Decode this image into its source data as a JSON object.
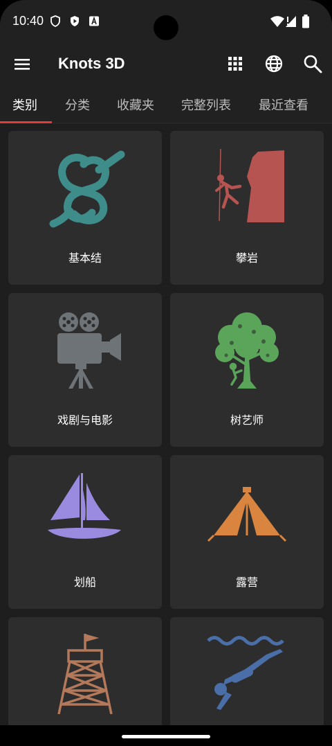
{
  "status": {
    "time": "10:40"
  },
  "app": {
    "title": "Knots 3D"
  },
  "tabs": [
    "类别",
    "分类",
    "收藏夹",
    "完整列表",
    "最近查看"
  ],
  "categories": [
    {
      "label": "基本结",
      "icon": "knot-icon",
      "color": "#3f8d8a"
    },
    {
      "label": "攀岩",
      "icon": "climbing-icon",
      "color": "#b55450"
    },
    {
      "label": "戏剧与电影",
      "icon": "film-camera-icon",
      "color": "#6e7377"
    },
    {
      "label": "树艺师",
      "icon": "tree-icon",
      "color": "#5aa55a"
    },
    {
      "label": "划船",
      "icon": "sailboat-icon",
      "color": "#9b8be0"
    },
    {
      "label": "露营",
      "icon": "tent-icon",
      "color": "#d9853f"
    },
    {
      "label": "",
      "icon": "tower-icon",
      "color": "#b3795a"
    },
    {
      "label": "",
      "icon": "diver-icon",
      "color": "#4a6fa8"
    }
  ]
}
